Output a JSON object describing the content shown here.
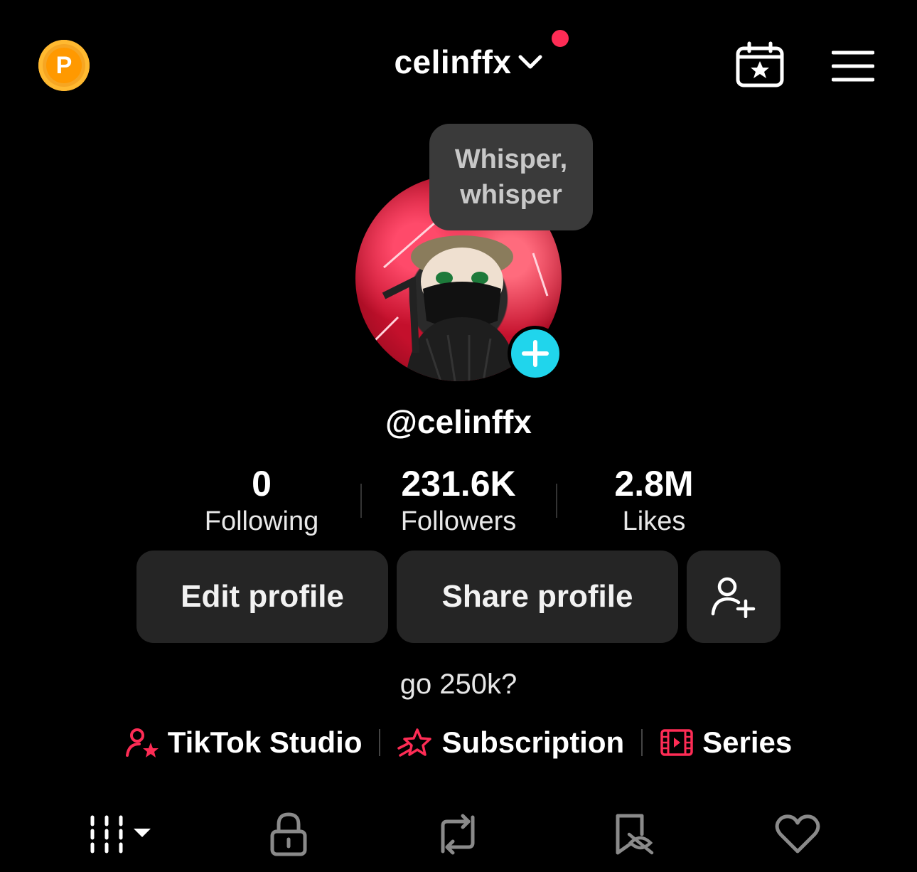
{
  "header": {
    "coin_label": "P",
    "username": "celinffx"
  },
  "tooltip": {
    "line1": "Whisper,",
    "line2": "whisper"
  },
  "profile": {
    "handle": "@celinffx",
    "bio": "go 250k?"
  },
  "stats": [
    {
      "value": "0",
      "label": "Following"
    },
    {
      "value": "231.6K",
      "label": "Followers"
    },
    {
      "value": "2.8M",
      "label": "Likes"
    }
  ],
  "buttons": {
    "edit": "Edit profile",
    "share": "Share profile"
  },
  "links": [
    {
      "label": "TikTok Studio",
      "icon": "person-star-icon"
    },
    {
      "label": "Subscription",
      "icon": "star-ribbon-icon"
    },
    {
      "label": "Series",
      "icon": "film-play-icon"
    }
  ],
  "colors": {
    "accent_red": "#fe2c55",
    "accent_cyan": "#20d5ec",
    "coin": "#ff9900",
    "button_bg": "#252525"
  },
  "tabs": [
    {
      "icon": "grid-icon"
    },
    {
      "icon": "lock-icon"
    },
    {
      "icon": "repost-icon"
    },
    {
      "icon": "bookmark-eye-icon"
    },
    {
      "icon": "heart-icon"
    }
  ]
}
